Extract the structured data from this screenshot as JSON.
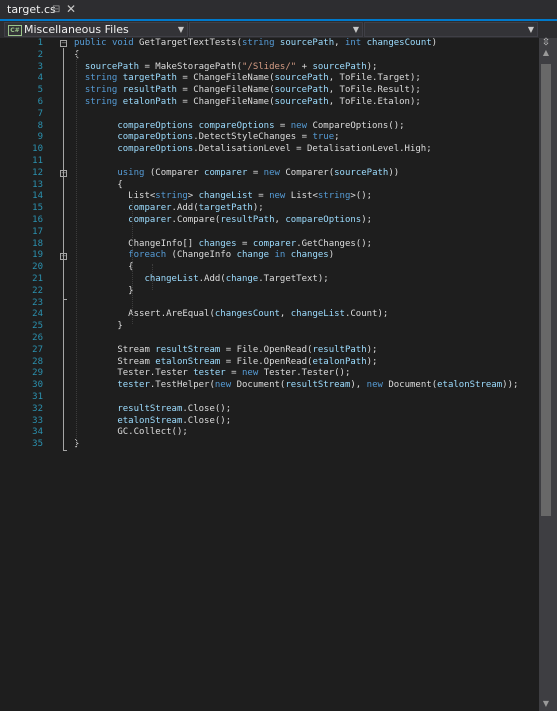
{
  "tab": {
    "title": "target.cs",
    "pin": "⊟",
    "close": "✕"
  },
  "navbar": {
    "project": "Miscellaneous Files",
    "type_member": "",
    "member": "",
    "icon_text": "C#"
  },
  "editor": {
    "lines": [
      {
        "n": "1",
        "t": [
          [
            "k",
            "public "
          ],
          [
            "k",
            "void "
          ],
          [
            "p",
            "GetTargetTextTests("
          ],
          [
            "k",
            "string "
          ],
          [
            "v",
            "sourcePath"
          ],
          [
            "p",
            ", "
          ],
          [
            "k",
            "int "
          ],
          [
            "v",
            "changesCount"
          ],
          [
            "p",
            ")"
          ]
        ]
      },
      {
        "n": "2",
        "t": [
          [
            "p",
            "{"
          ]
        ]
      },
      {
        "n": "3",
        "t": [
          [
            "v",
            "  sourcePath"
          ],
          [
            "p",
            " = MakeStoragePath("
          ],
          [
            "s",
            "\"/Slides/\""
          ],
          [
            "p",
            " + "
          ],
          [
            "v",
            "sourcePath"
          ],
          [
            "p",
            ");"
          ]
        ]
      },
      {
        "n": "4",
        "t": [
          [
            "k",
            "  string "
          ],
          [
            "v",
            "targetPath"
          ],
          [
            "p",
            " = ChangeFileName("
          ],
          [
            "v",
            "sourcePath"
          ],
          [
            "p",
            ", ToFile.Target);"
          ]
        ]
      },
      {
        "n": "5",
        "t": [
          [
            "k",
            "  string "
          ],
          [
            "v",
            "resultPath"
          ],
          [
            "p",
            " = ChangeFileName("
          ],
          [
            "v",
            "sourcePath"
          ],
          [
            "p",
            ", ToFile.Result);"
          ]
        ]
      },
      {
        "n": "6",
        "t": [
          [
            "k",
            "  string "
          ],
          [
            "v",
            "etalonPath"
          ],
          [
            "p",
            " = ChangeFileName("
          ],
          [
            "v",
            "sourcePath"
          ],
          [
            "p",
            ", ToFile.Etalon);"
          ]
        ]
      },
      {
        "n": "7",
        "t": []
      },
      {
        "n": "8",
        "t": [
          [
            "v",
            "        compareOptions"
          ],
          [
            "p",
            " "
          ],
          [
            "v",
            "compareOptions"
          ],
          [
            "p",
            " = "
          ],
          [
            "k",
            "new "
          ],
          [
            "p",
            "CompareOptions();"
          ]
        ]
      },
      {
        "n": "9",
        "t": [
          [
            "v",
            "        compareOptions"
          ],
          [
            "p",
            ".DetectStyleChanges = "
          ],
          [
            "k",
            "true"
          ],
          [
            "p",
            ";"
          ]
        ]
      },
      {
        "n": "10",
        "t": [
          [
            "v",
            "        compareOptions"
          ],
          [
            "p",
            ".DetalisationLevel = DetalisationLevel.High;"
          ]
        ]
      },
      {
        "n": "11",
        "t": []
      },
      {
        "n": "12",
        "t": [
          [
            "k",
            "        using "
          ],
          [
            "p",
            "(Comparer "
          ],
          [
            "v",
            "comparer"
          ],
          [
            "p",
            " = "
          ],
          [
            "k",
            "new "
          ],
          [
            "p",
            "Comparer("
          ],
          [
            "v",
            "sourcePath"
          ],
          [
            "p",
            "))"
          ]
        ]
      },
      {
        "n": "13",
        "t": [
          [
            "p",
            "        {"
          ]
        ]
      },
      {
        "n": "14",
        "t": [
          [
            "p",
            "          List<"
          ],
          [
            "k",
            "string"
          ],
          [
            "p",
            "> "
          ],
          [
            "v",
            "changeList"
          ],
          [
            "p",
            " = "
          ],
          [
            "k",
            "new "
          ],
          [
            "p",
            "List<"
          ],
          [
            "k",
            "string"
          ],
          [
            "p",
            ">();"
          ]
        ]
      },
      {
        "n": "15",
        "t": [
          [
            "v",
            "          comparer"
          ],
          [
            "p",
            ".Add("
          ],
          [
            "v",
            "targetPath"
          ],
          [
            "p",
            ");"
          ]
        ]
      },
      {
        "n": "16",
        "t": [
          [
            "v",
            "          comparer"
          ],
          [
            "p",
            ".Compare("
          ],
          [
            "v",
            "resultPath"
          ],
          [
            "p",
            ", "
          ],
          [
            "v",
            "compareOptions"
          ],
          [
            "p",
            ");"
          ]
        ]
      },
      {
        "n": "17",
        "t": []
      },
      {
        "n": "18",
        "t": [
          [
            "p",
            "          ChangeInfo[] "
          ],
          [
            "v",
            "changes"
          ],
          [
            "p",
            " = "
          ],
          [
            "v",
            "comparer"
          ],
          [
            "p",
            ".GetChanges();"
          ]
        ]
      },
      {
        "n": "19",
        "t": [
          [
            "k",
            "          foreach "
          ],
          [
            "p",
            "(ChangeInfo "
          ],
          [
            "v",
            "change"
          ],
          [
            "k",
            " in "
          ],
          [
            "v",
            "changes"
          ],
          [
            "p",
            ")"
          ]
        ]
      },
      {
        "n": "20",
        "t": [
          [
            "p",
            "          {"
          ]
        ]
      },
      {
        "n": "21",
        "t": [
          [
            "v",
            "             changeList"
          ],
          [
            "p",
            ".Add("
          ],
          [
            "v",
            "change"
          ],
          [
            "p",
            ".TargetText);"
          ]
        ]
      },
      {
        "n": "22",
        "t": [
          [
            "p",
            "          }"
          ]
        ]
      },
      {
        "n": "23",
        "t": []
      },
      {
        "n": "24",
        "t": [
          [
            "p",
            "          Assert.AreEqual("
          ],
          [
            "v",
            "changesCount"
          ],
          [
            "p",
            ", "
          ],
          [
            "v",
            "changeList"
          ],
          [
            "p",
            ".Count);"
          ]
        ]
      },
      {
        "n": "25",
        "t": [
          [
            "p",
            "        }"
          ]
        ]
      },
      {
        "n": "26",
        "t": []
      },
      {
        "n": "27",
        "t": [
          [
            "p",
            "        Stream "
          ],
          [
            "v",
            "resultStream"
          ],
          [
            "p",
            " = File.OpenRead("
          ],
          [
            "v",
            "resultPath"
          ],
          [
            "p",
            ");"
          ]
        ]
      },
      {
        "n": "28",
        "t": [
          [
            "p",
            "        Stream "
          ],
          [
            "v",
            "etalonStream"
          ],
          [
            "p",
            " = File.OpenRead("
          ],
          [
            "v",
            "etalonPath"
          ],
          [
            "p",
            ");"
          ]
        ]
      },
      {
        "n": "29",
        "t": [
          [
            "p",
            "        Tester.Tester "
          ],
          [
            "v",
            "tester"
          ],
          [
            "p",
            " = "
          ],
          [
            "k",
            "new "
          ],
          [
            "p",
            "Tester.Tester();"
          ]
        ]
      },
      {
        "n": "30",
        "t": [
          [
            "v",
            "        tester"
          ],
          [
            "p",
            ".TestHelper("
          ],
          [
            "k",
            "new "
          ],
          [
            "p",
            "Document("
          ],
          [
            "v",
            "resultStream"
          ],
          [
            "p",
            "), "
          ],
          [
            "k",
            "new "
          ],
          [
            "p",
            "Document("
          ],
          [
            "v",
            "etalonStream"
          ],
          [
            "p",
            "));"
          ]
        ]
      },
      {
        "n": "31",
        "t": []
      },
      {
        "n": "32",
        "t": [
          [
            "v",
            "        resultStream"
          ],
          [
            "p",
            ".Close();"
          ]
        ]
      },
      {
        "n": "33",
        "t": [
          [
            "v",
            "        etalonStream"
          ],
          [
            "p",
            ".Close();"
          ]
        ]
      },
      {
        "n": "34",
        "t": [
          [
            "p",
            "        GC.Collect();"
          ]
        ]
      },
      {
        "n": "35",
        "t": [
          [
            "p",
            "}"
          ]
        ]
      }
    ]
  },
  "scrollbar": {
    "up": "▲",
    "down": "▼",
    "split": "⇳"
  },
  "colors": {
    "keyword": "#569cd6",
    "string": "#d69d85",
    "variable": "#9cdcfe",
    "plain": "#dcdcdc",
    "line_number": "#2b91af",
    "accent": "#007acc"
  }
}
